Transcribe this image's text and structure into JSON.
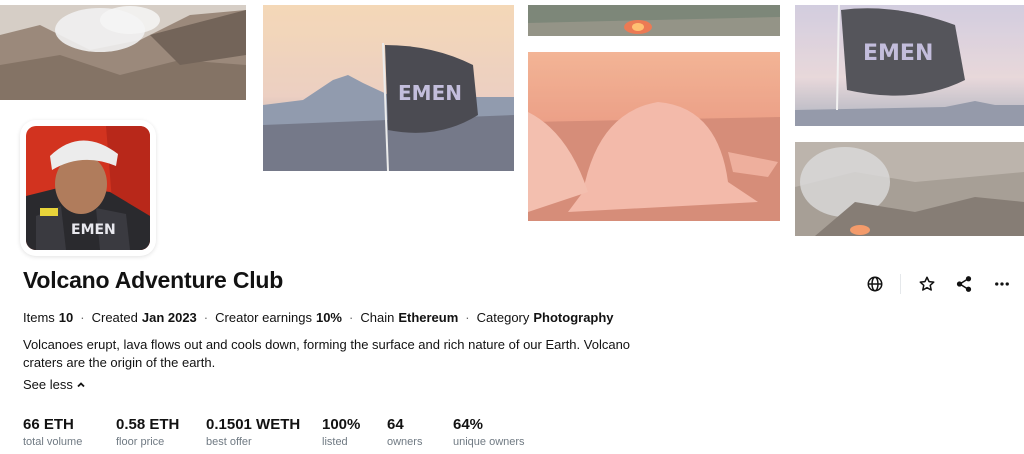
{
  "collection": {
    "title": "Volcano Adventure Club",
    "meta": [
      {
        "label": "Items",
        "value": "10"
      },
      {
        "label": "Created",
        "value": "Jan 2023"
      },
      {
        "label": "Creator earnings",
        "value": "10%"
      },
      {
        "label": "Chain",
        "value": "Ethereum"
      },
      {
        "label": "Category",
        "value": "Photography"
      }
    ],
    "description": "Volcanoes erupt, lava flows out and cools down, forming the surface and rich nature of our Earth. Volcano craters are the origin of the earth.",
    "see_less_label": "See less"
  },
  "actions": {
    "website_icon": "globe-icon",
    "favorite_icon": "star-icon",
    "share_icon": "share-icon",
    "more_icon": "more-horizontal-icon"
  },
  "stats": [
    {
      "value": "66 ETH",
      "label": "total volume"
    },
    {
      "value": "0.58 ETH",
      "label": "floor price"
    },
    {
      "value": "0.1501 WETH",
      "label": "best offer"
    },
    {
      "value": "100%",
      "label": "listed"
    },
    {
      "value": "64",
      "label": "owners"
    },
    {
      "value": "64%",
      "label": "unique owners"
    }
  ],
  "flag_text": "EMEN",
  "avatar_shirt_text": "EMEN",
  "colors": {
    "text": "#121212",
    "muted": "#707a83",
    "divider": "#e5e8eb"
  }
}
